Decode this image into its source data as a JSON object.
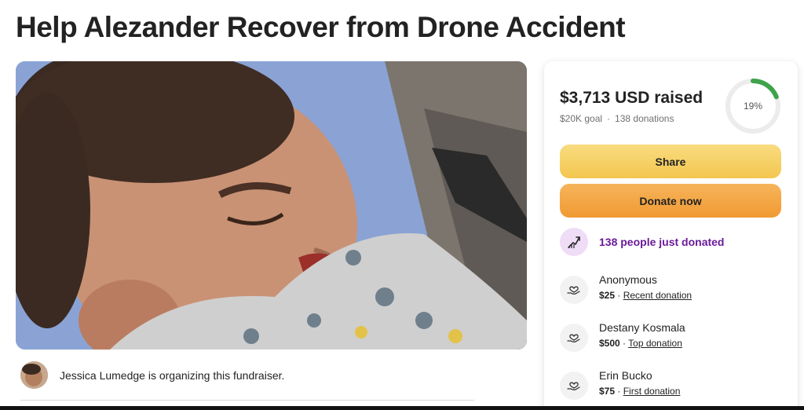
{
  "campaign": {
    "title": "Help Alezander Recover from Drone Accident"
  },
  "organizer": {
    "text": "Jessica Lumedge is organizing this fundraiser."
  },
  "progress": {
    "raised": "$3,713 USD raised",
    "goal": "$20K goal",
    "separator": "·",
    "donations": "138 donations",
    "percent_label": "19%",
    "fraction": 0.19,
    "ring_color": "#3ea34a"
  },
  "actions": {
    "share_label": "Share",
    "donate_label": "Donate now"
  },
  "trend": {
    "text": "138 people just donated",
    "icon": "trending-up-icon"
  },
  "donations": [
    {
      "name": "Anonymous",
      "amount": "$25",
      "sep": " · ",
      "tag": "Recent donation"
    },
    {
      "name": "Destany Kosmala",
      "amount": "$500",
      "sep": " · ",
      "tag": "Top donation"
    },
    {
      "name": "Erin Bucko",
      "amount": "$75",
      "sep": " · ",
      "tag": "First donation"
    }
  ],
  "colors": {
    "accent_purple": "#6a1b9a",
    "share_yellow": "#f3c64f",
    "donate_orange": "#f09a32"
  }
}
